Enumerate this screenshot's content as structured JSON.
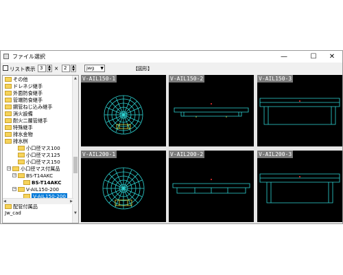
{
  "window": {
    "title": "ファイル選択",
    "controls": {
      "minimize": "—",
      "maximize": "☐",
      "close": "✕"
    }
  },
  "toolbar": {
    "list_label": "リスト表示",
    "cols_value": "3",
    "times_sign": "×",
    "rows_value": "2",
    "ext_value": "jwg",
    "preview_label": "【図形】"
  },
  "tree": {
    "items": [
      {
        "label": "その他"
      },
      {
        "label": "ドレネジ継手"
      },
      {
        "label": "外面防食継手"
      },
      {
        "label": "管端防食継手"
      },
      {
        "label": "鋼管ねじ込み継手"
      },
      {
        "label": "消火設備"
      },
      {
        "label": "耐火二層管継手"
      },
      {
        "label": "特殊継手"
      },
      {
        "label": "排水金物"
      },
      {
        "label": "排水桝"
      },
      {
        "label": "小口径マス100"
      },
      {
        "label": "小口径マス125"
      },
      {
        "label": "小口径マス150"
      },
      {
        "label": "小口径マス付属品"
      },
      {
        "label": "BS-T14AKC"
      },
      {
        "label": "BS-T14AKC"
      },
      {
        "label": "V-AIL150-200"
      },
      {
        "label": "V-AIL150-200"
      },
      {
        "label": "配管付属品"
      }
    ],
    "status": "Jw_cad",
    "collapse_sign": "−"
  },
  "thumbnails": [
    {
      "name": "V-AIL150-1"
    },
    {
      "name": "V-AIL150-2"
    },
    {
      "name": "V-AIL150-3"
    },
    {
      "name": "V-AIL200-1"
    },
    {
      "name": "V-AIL200-2"
    },
    {
      "name": "V-AIL200-3"
    }
  ],
  "colors": {
    "cad_cyan": "#2fd8d8",
    "cad_yellow": "#e8e84a",
    "cad_red": "#ff3030",
    "selection": "#0078d7"
  }
}
